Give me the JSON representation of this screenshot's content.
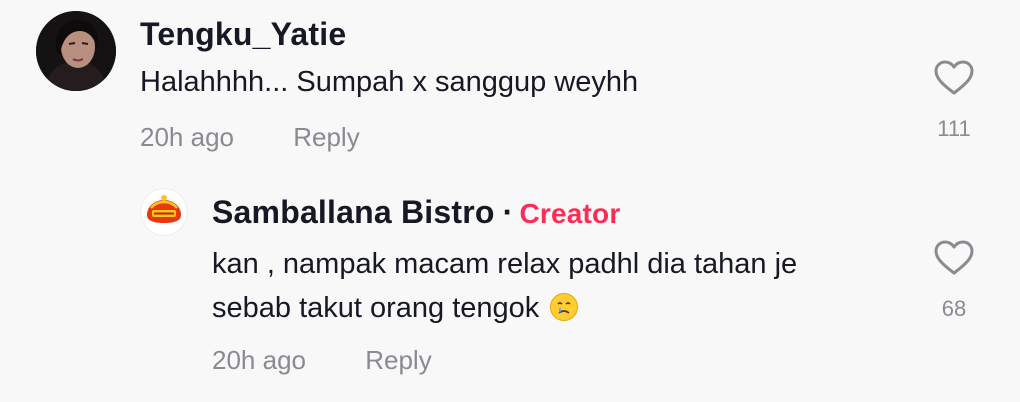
{
  "comment": {
    "username": "Tengku_Yatie",
    "text": "Halahhhh... Sumpah x sanggup weyhh",
    "time": "20h ago",
    "reply_label": "Reply",
    "likes": "111",
    "avatar": "profile-photo-woman"
  },
  "reply": {
    "username": "Samballana Bistro",
    "separator": "·",
    "badge": "Creator",
    "text_line1": "kan , nampak macam relax padhl dia tahan je",
    "text_line2": "sebab takut orang tengok",
    "emoji": "crying-face-emoji",
    "time": "20h ago",
    "reply_label": "Reply",
    "likes": "68",
    "avatar": "samballana-bistro-logo"
  },
  "colors": {
    "background": "#f8f8f8",
    "text": "#161823",
    "muted": "#8a8b91",
    "creator_badge": "#fe2c55"
  },
  "icons": {
    "like": "heart-outline-icon"
  }
}
